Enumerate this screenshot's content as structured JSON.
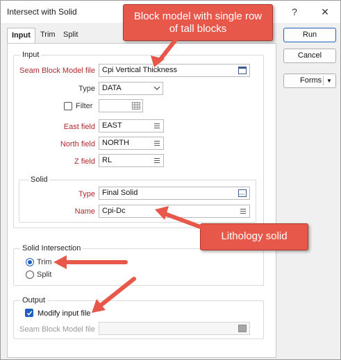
{
  "window": {
    "title": "Intersect with Solid",
    "help_label": "?",
    "close_label": "✕"
  },
  "tabs": [
    {
      "label": "Input",
      "active": true
    },
    {
      "label": "Trim",
      "active": false
    },
    {
      "label": "Split",
      "active": false
    }
  ],
  "input_group": {
    "title": "Input",
    "seam_block_model_file": {
      "label": "Seam Block Model file",
      "value": "Cpi Vertical Thickness"
    },
    "type": {
      "label": "Type",
      "value": "DATA"
    },
    "filter": {
      "label": "Filter",
      "checked": false,
      "value": ""
    },
    "east_field": {
      "label": "East field",
      "value": "EAST"
    },
    "north_field": {
      "label": "North field",
      "value": "NORTH"
    },
    "z_field": {
      "label": "Z field",
      "value": "RL"
    }
  },
  "solid_group": {
    "title": "Solid",
    "type": {
      "label": "Type",
      "value": "Final Solid"
    },
    "name": {
      "label": "Name",
      "value": "Cpi-Dc"
    }
  },
  "solid_intersection": {
    "title": "Solid Intersection",
    "options": [
      {
        "label": "Trim",
        "selected": true
      },
      {
        "label": "Split",
        "selected": false
      }
    ]
  },
  "output_group": {
    "title": "Output",
    "modify_input_file": {
      "label": "Modify input file",
      "checked": true
    },
    "seam_block_model_file": {
      "label": "Seam Block Model file",
      "value": ""
    }
  },
  "buttons": {
    "run": "Run",
    "cancel": "Cancel",
    "forms": "Forms",
    "forms_dropdown": "▼"
  },
  "annotations": {
    "block_model": "Block model with single row of tall blocks",
    "lithology": "Lithology solid"
  },
  "colors": {
    "accent": "#1f5fbf",
    "required_label": "#b0282d",
    "callout_fill": "#e8584a",
    "callout_border": "#a8372d"
  }
}
